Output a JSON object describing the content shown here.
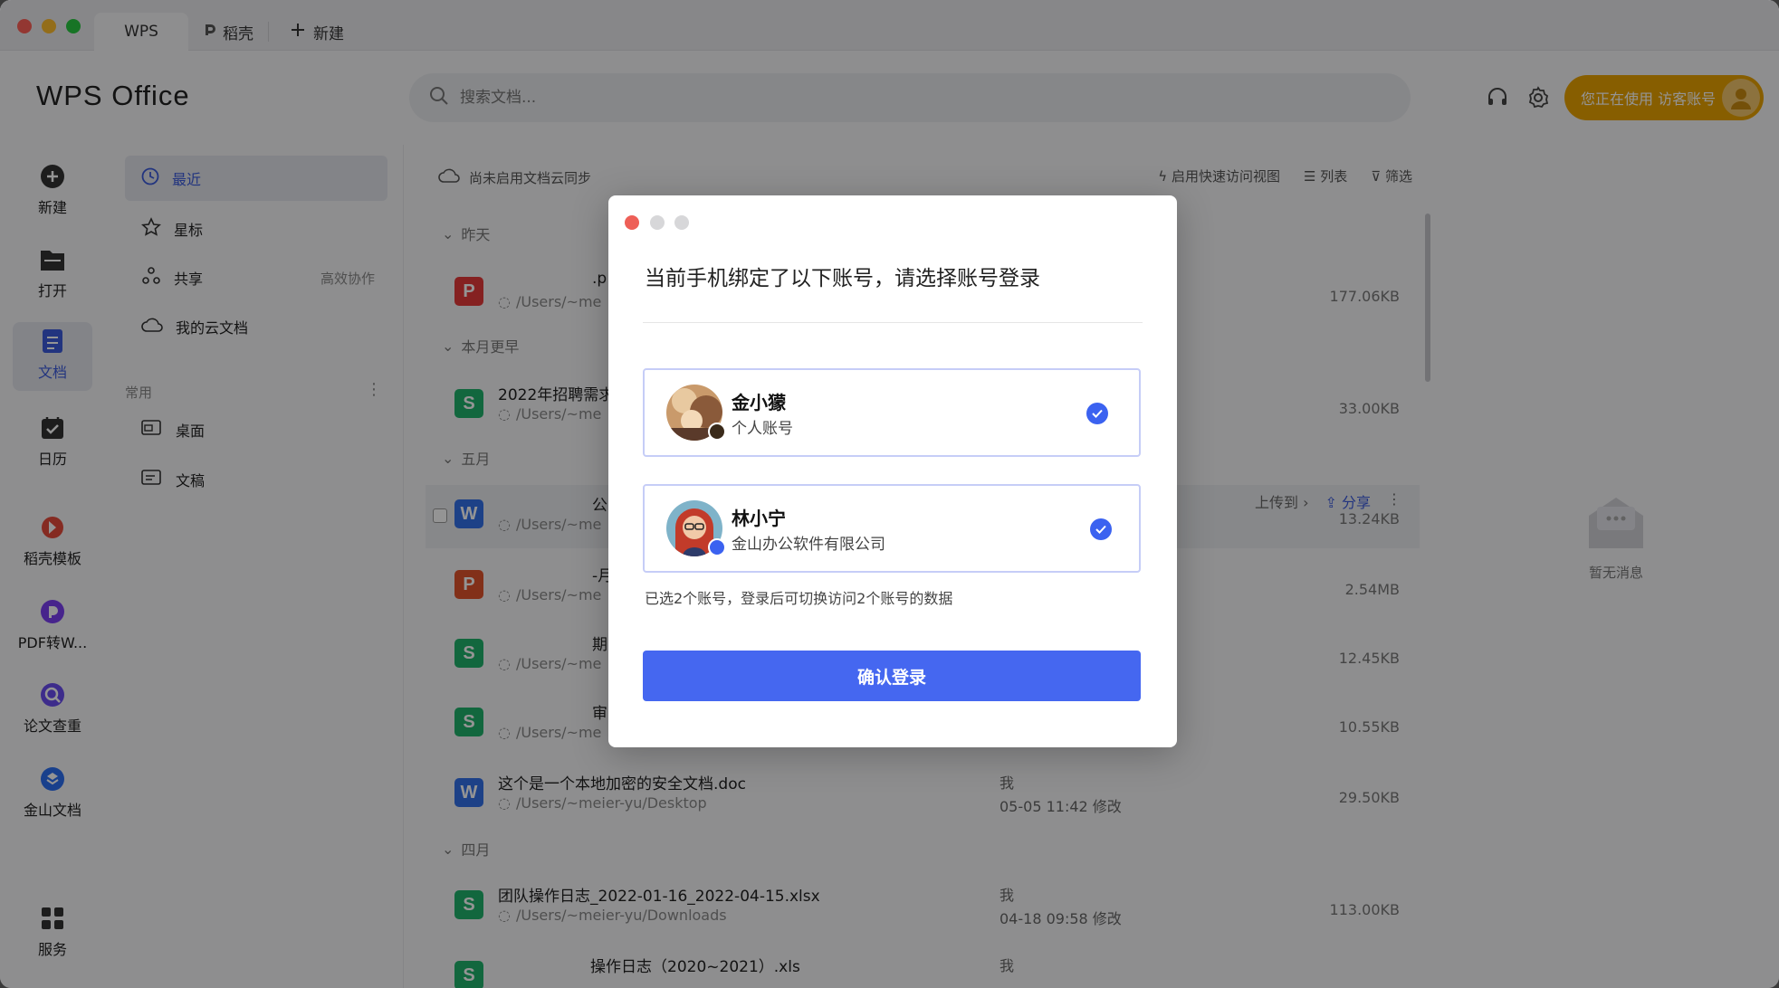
{
  "tabs": [
    {
      "label": "WPS"
    },
    {
      "label": "稻壳"
    },
    {
      "label": "新建"
    }
  ],
  "header": {
    "logo": "WPS Office",
    "search_placeholder": "搜索文档...",
    "guest_label": "您正在使用 访客账号"
  },
  "rail": [
    {
      "label": "新建",
      "icon": "plus-circle-icon"
    },
    {
      "label": "打开",
      "icon": "folder-icon"
    },
    {
      "label": "文档",
      "icon": "document-icon"
    },
    {
      "label": "日历",
      "icon": "calendar-icon"
    },
    {
      "label": "稻壳模板",
      "icon": "daoke-icon"
    },
    {
      "label": "PDF转W...",
      "icon": "pdf-convert-icon"
    },
    {
      "label": "论文查重",
      "icon": "paper-check-icon"
    },
    {
      "label": "金山文档",
      "icon": "kingsoft-docs-icon"
    },
    {
      "label": "服务",
      "icon": "grid-icon"
    }
  ],
  "nav": {
    "recent": "最近",
    "starred": "星标",
    "shared": "共享",
    "shared_extra": "高效协作",
    "cloud": "我的云文档",
    "section": "常用",
    "desktop": "桌面",
    "docs": "文稿"
  },
  "toolbar": {
    "sync": "尚未启用文档云同步",
    "quick_view": "启用快速访问视图",
    "list": "列表",
    "filter": "筛选"
  },
  "groups": {
    "yesterday": "昨天",
    "earlier_month": "本月更早",
    "may": "五月",
    "april": "四月"
  },
  "files": [
    {
      "name": ".p",
      "path": "/Users/~me",
      "size": "177.06KB",
      "type": "P"
    },
    {
      "name": "2022年招聘需求",
      "path": "/Users/~me",
      "size": "33.00KB",
      "type": "S"
    },
    {
      "name": "公",
      "path": "/Users/~me",
      "size": "13.24KB",
      "type": "W",
      "upload": "上传到",
      "share": "分享"
    },
    {
      "name": "-月",
      "path": "/Users/~me",
      "size": "2.54MB",
      "type": "P"
    },
    {
      "name": "期",
      "path": "/Users/~me",
      "size": "12.45KB",
      "type": "S"
    },
    {
      "name": "审",
      "path": "/Users/~me",
      "size": "10.55KB",
      "type": "S"
    },
    {
      "name": "这个是一个本地加密的安全文档.doc",
      "path": "/Users/~meier-yu/Desktop",
      "owner": "我",
      "date": "05-05 11:42 修改",
      "size": "29.50KB",
      "type": "W"
    },
    {
      "name": "团队操作日志_2022-01-16_2022-04-15.xlsx",
      "path": "/Users/~meier-yu/Downloads",
      "owner": "我",
      "date": "04-18 09:58 修改",
      "size": "113.00KB",
      "type": "S"
    },
    {
      "name": "操作日志（2020~2021）.xls",
      "owner": "我",
      "type": "S"
    }
  ],
  "notifications": {
    "empty": "暂无消息"
  },
  "dialog": {
    "title": "当前手机绑定了以下账号，请选择账号登录",
    "accounts": [
      {
        "name": "金小獴",
        "sub": "个人账号"
      },
      {
        "name": "林小宁",
        "sub": "金山办公软件有限公司"
      }
    ],
    "hint": "已选2个账号，登录后可切换访问2个账号的数据",
    "confirm": "确认登录"
  },
  "colors": {
    "accent": "#4567f0",
    "guest": "#e9a200"
  }
}
